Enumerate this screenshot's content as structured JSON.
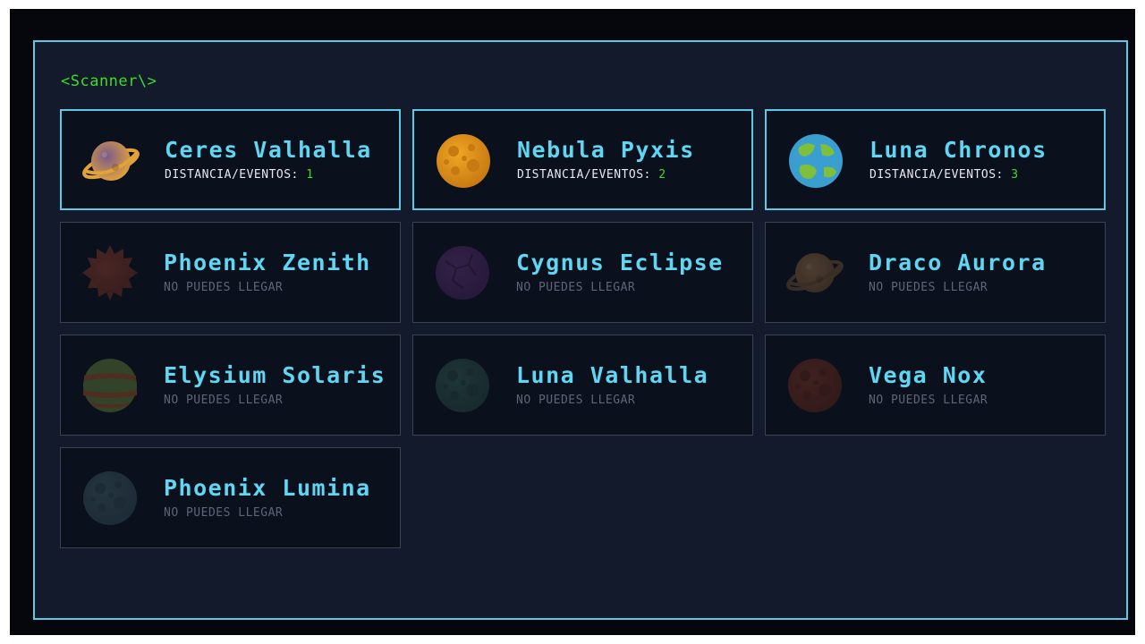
{
  "scanner": {
    "title": "<Scanner\\>"
  },
  "planets": [
    {
      "name": "Ceres Valhalla",
      "reachable": true,
      "status_label": "DISTANCIA/EVENTOS:",
      "status_value": "1",
      "icon": "ringed-planet-icon",
      "colors": [
        "#7a5a8c",
        "#e0a23a"
      ]
    },
    {
      "name": "Nebula Pyxis",
      "reachable": true,
      "status_label": "DISTANCIA/EVENTOS:",
      "status_value": "2",
      "icon": "cratered-planet-icon",
      "colors": [
        "#f0a524",
        "#c77a12"
      ]
    },
    {
      "name": "Luna Chronos",
      "reachable": true,
      "status_label": "DISTANCIA/EVENTOS:",
      "status_value": "3",
      "icon": "earthlike-planet-icon",
      "colors": [
        "#3a9fd0",
        "#7fbf3a"
      ]
    },
    {
      "name": "Phoenix Zenith",
      "reachable": false,
      "status_label": "NO PUEDES LLEGAR",
      "icon": "spiky-planet-icon",
      "colors": [
        "#a0482e",
        "#7a3220"
      ]
    },
    {
      "name": "Cygnus Eclipse",
      "reachable": false,
      "status_label": "NO PUEDES LLEGAR",
      "icon": "cracked-planet-icon",
      "colors": [
        "#6a3a82",
        "#4e2866"
      ]
    },
    {
      "name": "Draco Aurora",
      "reachable": false,
      "status_label": "NO PUEDES LLEGAR",
      "icon": "ringed-planet-icon",
      "colors": [
        "#a87a4a",
        "#7a5830"
      ]
    },
    {
      "name": "Elysium Solaris",
      "reachable": false,
      "status_label": "NO PUEDES LLEGAR",
      "icon": "gas-planet-icon",
      "colors": [
        "#6a8a3a",
        "#a85a2a"
      ]
    },
    {
      "name": "Luna Valhalla",
      "reachable": false,
      "status_label": "NO PUEDES LLEGAR",
      "icon": "cratered-planet-icon",
      "colors": [
        "#3a6a5a",
        "#2a4e44"
      ]
    },
    {
      "name": "Vega Nox",
      "reachable": false,
      "status_label": "NO PUEDES LLEGAR",
      "icon": "cratered-planet-icon",
      "colors": [
        "#8a3a22",
        "#6a2a18"
      ]
    },
    {
      "name": "Phoenix Lumina",
      "reachable": false,
      "status_label": "NO PUEDES LLEGAR",
      "icon": "cratered-planet-icon",
      "colors": [
        "#4a6a72",
        "#36525a"
      ]
    }
  ]
}
